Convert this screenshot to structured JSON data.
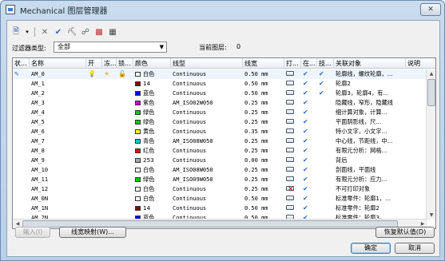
{
  "window": {
    "title": "Mechanical 图层管理器",
    "close_glyph": "✕"
  },
  "toolbar": {
    "icons": [
      "new-layer-icon",
      "dropdown-arrow-icon",
      "delete-layer-icon",
      "set-current-icon",
      "layer-states-icon",
      "filter-icon",
      "color-palette-icon",
      "grid-icon"
    ],
    "glyphs": [
      "🗎",
      "▾",
      "✕",
      "✔",
      "⛏",
      "☍",
      "▩",
      "▦"
    ]
  },
  "filter": {
    "label": "过滤器类型:",
    "value": "全部"
  },
  "current_layer": {
    "label": "当前图层:",
    "value": "0"
  },
  "columns": [
    "状...",
    "名称",
    "开",
    "冻...",
    "锁...",
    "颜色",
    "线型",
    "线宽",
    "打...",
    "在...",
    "技...",
    "关联对象",
    "说明"
  ],
  "rows": [
    {
      "name": "AM_0",
      "on": true,
      "freeze": true,
      "lock": true,
      "color_name": "白色",
      "color": "#ffffff",
      "linetype": "Continuous",
      "lineweight": "0.50 mm",
      "plot": true,
      "vp": true,
      "tech": true,
      "assoc": "轮廓线，螺纹轮廓，...",
      "current": true
    },
    {
      "name": "AM_1",
      "color_name": "14",
      "color": "#8b0000",
      "linetype": "Continuous",
      "lineweight": "0.50 mm",
      "plot": true,
      "vp": true,
      "tech": true,
      "assoc": "轮廓2"
    },
    {
      "name": "AM_2",
      "color_name": "蓝色",
      "color": "#0000ff",
      "linetype": "Continuous",
      "lineweight": "0.50 mm",
      "plot": true,
      "vp": true,
      "tech": true,
      "assoc": "轮廓3，轮廓4，有..."
    },
    {
      "name": "AM_3",
      "color_name": "紫色",
      "color": "#cc00cc",
      "linetype": "AM_ISO02W050",
      "lineweight": "0.25 mm",
      "plot": true,
      "vp": true,
      "tech": false,
      "assoc": "隐藏线，窄形，隐藏线"
    },
    {
      "name": "AM_4",
      "color_name": "绿色",
      "color": "#00cc00",
      "linetype": "Continuous",
      "lineweight": "0.25 mm",
      "plot": true,
      "vp": true,
      "tech": false,
      "assoc": "细计算对象，计算..."
    },
    {
      "name": "AM_5",
      "color_name": "绿色",
      "color": "#00cc00",
      "linetype": "Continuous",
      "lineweight": "0.25 mm",
      "plot": true,
      "vp": true,
      "tech": false,
      "assoc": "平面阴影线，尺..."
    },
    {
      "name": "AM_6",
      "color_name": "黄色",
      "color": "#ffff00",
      "linetype": "Continuous",
      "lineweight": "0.35 mm",
      "plot": true,
      "vp": true,
      "tech": false,
      "assoc": "特小文字，小文字..."
    },
    {
      "name": "AM_7",
      "color_name": "青色",
      "color": "#00cccc",
      "linetype": "AM_ISO08W050",
      "lineweight": "0.25 mm",
      "plot": true,
      "vp": true,
      "tech": false,
      "assoc": "中心线，节距线，中..."
    },
    {
      "name": "AM_8",
      "color_name": "红色",
      "color": "#ff0000",
      "linetype": "Continuous",
      "lineweight": "0.25 mm",
      "plot": true,
      "vp": true,
      "tech": false,
      "assoc": "有限元分析：网格..."
    },
    {
      "name": "AM_9",
      "color_name": "253",
      "color": "#aaaaaa",
      "linetype": "Continuous",
      "lineweight": "0.00 mm",
      "plot": true,
      "vp": true,
      "tech": false,
      "assoc": "背后"
    },
    {
      "name": "AM_10",
      "color_name": "白色",
      "color": "#ffffff",
      "linetype": "AM_ISO08W050",
      "lineweight": "0.25 mm",
      "plot": true,
      "vp": true,
      "tech": false,
      "assoc": "剖面线，平面线"
    },
    {
      "name": "AM_11",
      "color_name": "绿色",
      "color": "#00cc00",
      "linetype": "AM_ISO09W050",
      "lineweight": "0.25 mm",
      "plot": true,
      "vp": true,
      "tech": false,
      "assoc": "有限元分析：应力..."
    },
    {
      "name": "AM_12",
      "color_name": "白色",
      "color": "#ffffff",
      "linetype": "Continuous",
      "lineweight": "0.25 mm",
      "plot": false,
      "vp": true,
      "tech": false,
      "assoc": "不可打印对象"
    },
    {
      "name": "AM_0N",
      "color_name": "白色",
      "color": "#ffffff",
      "linetype": "Continuous",
      "lineweight": "0.50 mm",
      "plot": true,
      "vp": true,
      "tech": false,
      "assoc": "标准零件：轮廓1，..."
    },
    {
      "name": "AM_1N",
      "color_name": "14",
      "color": "#8b0000",
      "linetype": "Continuous",
      "lineweight": "0.50 mm",
      "plot": true,
      "vp": true,
      "tech": false,
      "assoc": "标准零件：轮廓2"
    },
    {
      "name": "AM_2N",
      "color_name": "蓝色",
      "color": "#0000ff",
      "linetype": "Continuous",
      "lineweight": "0.50 mm",
      "plot": true,
      "vp": true,
      "tech": false,
      "assoc": "标准零件：轮廓3，..."
    }
  ],
  "buttons": {
    "import": "输入(I)",
    "linetype_map": "线宽映射(W)...",
    "restore_defaults": "恢复默认值(D)",
    "ok": "确定",
    "cancel": "取消"
  }
}
